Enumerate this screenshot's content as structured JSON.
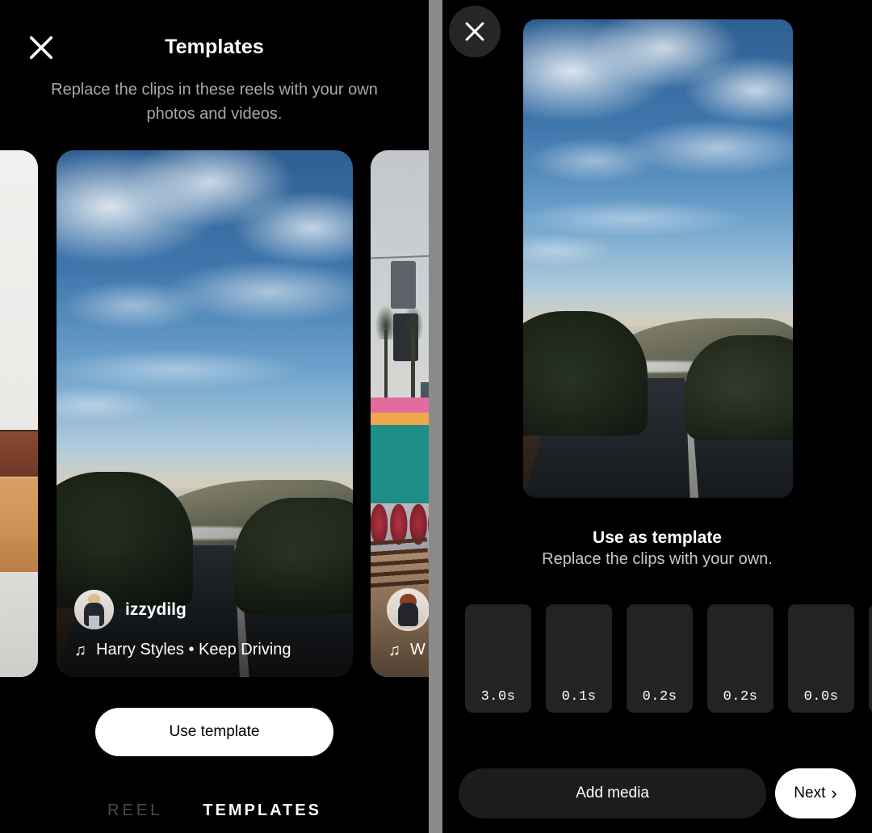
{
  "left_panel": {
    "close_icon": "close-icon",
    "title": "Templates",
    "subtitle": "Replace the clips in these reels with your own photos and videos.",
    "cards": [
      {
        "photo": "interior-chair",
        "username": "",
        "music": "",
        "partial": "left"
      },
      {
        "photo": "coastal-road-sunset",
        "username": "izzydilg",
        "music": "Harry Styles • Keep Driving",
        "music_icon": "music-note-icon",
        "partial": "none"
      },
      {
        "photo": "boardwalk-fairground",
        "username": "",
        "music": "W",
        "music_icon": "music-note-icon",
        "partial": "right"
      }
    ],
    "use_template_label": "Use template",
    "tabs": [
      {
        "label": "REEL",
        "active": false
      },
      {
        "label": "TEMPLATES",
        "active": true
      }
    ]
  },
  "right_panel": {
    "close_icon": "close-icon",
    "preview_photo": "coastal-road-sunset",
    "title": "Use as template",
    "subtitle": "Replace the clips with your own.",
    "clips": [
      {
        "duration": "3.0s"
      },
      {
        "duration": "0.1s"
      },
      {
        "duration": "0.2s"
      },
      {
        "duration": "0.2s"
      },
      {
        "duration": "0.0s"
      },
      {
        "duration": ""
      }
    ],
    "add_media_label": "Add media",
    "next_label": "Next",
    "next_icon": "chevron-right-icon"
  },
  "colors": {
    "background": "#000000",
    "divider": "#8a8a8a",
    "primary_button": "#ffffff",
    "secondary_button": "#1c1c1c",
    "clip_tile": "#232323",
    "muted_text": "#a8a8a8",
    "inactive_tab": "#4a4a4a"
  }
}
